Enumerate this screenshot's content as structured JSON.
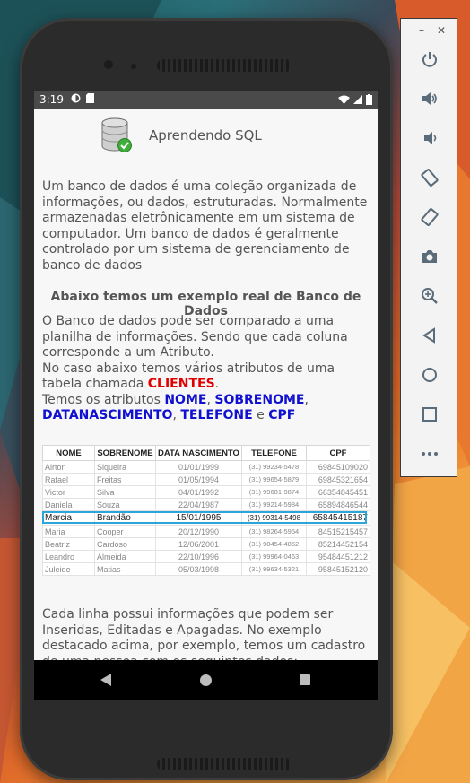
{
  "status_bar": {
    "time": "3:19"
  },
  "app": {
    "title": "Aprendendo SQL"
  },
  "content": {
    "paragraph1": "Um banco de dados é uma coleção organizada de informações, ou dados, estruturadas. Normalmente armazenadas eletrônicamente em um sistema de computador. Um banco de dados é geralmente controlado por um sistema de gerenciamento de banco de dados",
    "heading": "Abaixo temos um exemplo real de Banco de Dados",
    "paragraph2_line1": "O Banco de dados pode ser comparado a uma planilha de informações. Sendo que cada coluna corresponde a um Atributo.",
    "paragraph2_line2_prefix": "No caso abaixo temos vários atributos de uma tabela chamada ",
    "table_name": "CLIENTES",
    "table_name_suffix": ".",
    "attrs_prefix": "Temos os atributos ",
    "attr1": "NOME",
    "sep1": ", ",
    "attr2": "SOBRENOME",
    "sep2": ", ",
    "attr3": "DATANASCIMENTO",
    "sep3": ", ",
    "attr4": "TELEFONE",
    "sep4": " e ",
    "attr5": "CPF",
    "paragraph3": "Cada linha possui informações que podem ser Inseridas, Editadas e Apagadas. No exemplo destacado acima, por exemplo, temos um cadastro de uma pessoa com os seguintes dados:"
  },
  "table": {
    "headers": [
      "NOME",
      "SOBRENOME",
      "DATA NASCIMENTO",
      "TELEFONE",
      "CPF"
    ],
    "rows": [
      [
        "Airton",
        "Siqueira",
        "01/01/1999",
        "(31) 99234-5478",
        "69845109020"
      ],
      [
        "Rafael",
        "Freitas",
        "01/05/1994",
        "(31) 99654-5879",
        "69845321654"
      ],
      [
        "Victor",
        "Silva",
        "04/01/1992",
        "(31) 99681-9874",
        "66354845451"
      ],
      [
        "Daniela",
        "Souza",
        "22/04/1987",
        "(31) 99214-5984",
        "65894846544"
      ],
      [
        "Marcia",
        "Brandão",
        "15/01/1995",
        "(31) 99314-5498",
        "65845415187"
      ],
      [
        "Maria",
        "Cooper",
        "20/12/1990",
        "(31) 98264-5954",
        "84515215457"
      ],
      [
        "Beatriz",
        "Cardoso",
        "12/06/2001",
        "(31) 98454-4852",
        "85214452154"
      ],
      [
        "Leandro",
        "Almeida",
        "22/10/1996",
        "(31) 99964-0463",
        "95484451212"
      ],
      [
        "Juleide",
        "Matias",
        "05/03/1998",
        "(31) 99634-5321",
        "95845152120"
      ]
    ],
    "highlighted_row": 4
  },
  "emulator": {
    "buttons": [
      "power-icon",
      "volume-up-icon",
      "volume-down-icon",
      "rotate-left-icon",
      "rotate-right-icon",
      "camera-icon",
      "zoom-icon",
      "back-icon",
      "home-icon",
      "overview-icon",
      "more-icon"
    ]
  }
}
